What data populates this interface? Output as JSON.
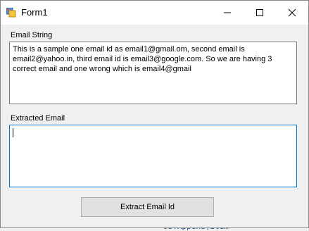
{
  "window": {
    "title": "Form1",
    "minimize_glyph": "—",
    "close_glyph": "✕"
  },
  "email_section": {
    "label": "Email String",
    "text": "This is a sample one email id as email1@gmail.om, second email is email2@yahoo.in, third email id is email3@google.com. So we are having 3 correct email and one wrong which is  email4@gmail"
  },
  "extracted_section": {
    "label": "Extracted Email",
    "value": ""
  },
  "actions": {
    "extract_label": "Extract Email Id"
  },
  "background": {
    "code_snippet": "sb.Append(item"
  },
  "colors": {
    "titlebar": "#ffffff",
    "client": "#f0f0f0",
    "focus_border": "#0078d7",
    "button_face": "#e1e1e1"
  },
  "icons": {
    "app": "form-app-icon",
    "minimize": "minimize-icon",
    "maximize": "maximize-icon",
    "close": "close-icon"
  }
}
